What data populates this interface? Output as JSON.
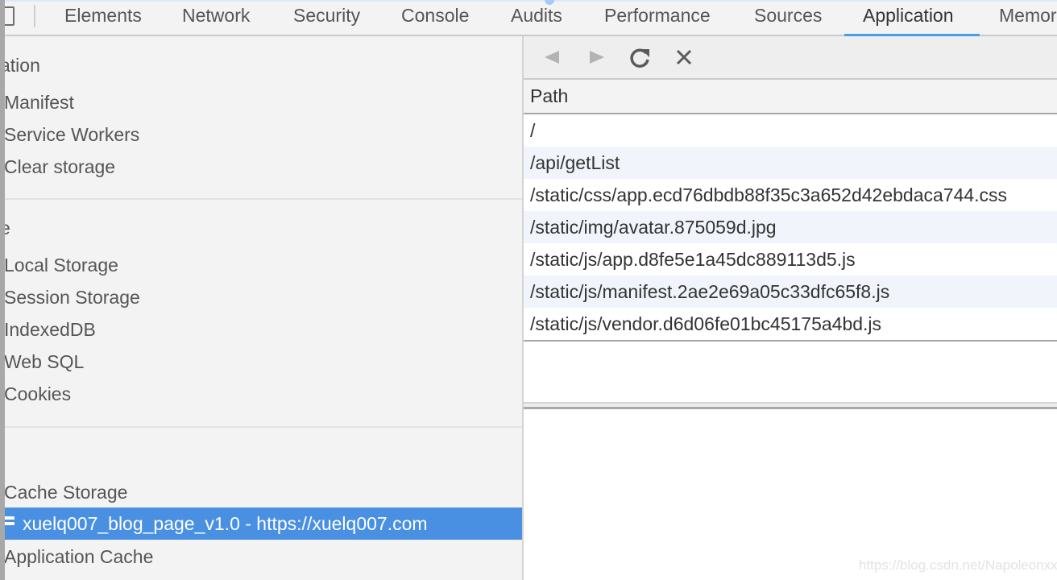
{
  "devtools": {
    "tabs": [
      {
        "label": "Elements",
        "active": false
      },
      {
        "label": "Network",
        "active": false
      },
      {
        "label": "Security",
        "active": false
      },
      {
        "label": "Console",
        "active": false
      },
      {
        "label": "Audits",
        "active": false
      },
      {
        "label": "Performance",
        "active": false
      },
      {
        "label": "Sources",
        "active": false
      },
      {
        "label": "Application",
        "active": true
      },
      {
        "label": "Memor",
        "active": false
      }
    ],
    "accent_color": "#4a90e2"
  },
  "sidebar": {
    "sections": [
      {
        "header": "ation",
        "items": [
          "Manifest",
          "Service Workers",
          "Clear storage"
        ]
      },
      {
        "header": "e",
        "items": [
          "Local Storage",
          "Session Storage",
          "IndexedDB",
          "Web SQL",
          "Cookies"
        ]
      },
      {
        "header": "",
        "items": [
          "Cache Storage"
        ]
      }
    ],
    "selected_item": "xuelq007_blog_page_v1.0 - https://xuelq007.com",
    "after_selected": "Application Cache"
  },
  "toolbar": {
    "icons": [
      "back-icon",
      "forward-icon",
      "refresh-icon",
      "delete-icon"
    ]
  },
  "table": {
    "column": "Path",
    "rows": [
      "/",
      "/api/getList",
      "/static/css/app.ecd76dbdb88f35c3a652d42ebdaca744.css",
      "/static/img/avatar.875059d.jpg",
      "/static/js/app.d8fe5e1a45dc889113d5.js",
      "/static/js/manifest.2ae2e69a05c33dfc65f8.js",
      "/static/js/vendor.d6d06fe01bc45175a4bd.js"
    ]
  },
  "watermark": "https://blog.csdn.net/Napoleonxxx"
}
